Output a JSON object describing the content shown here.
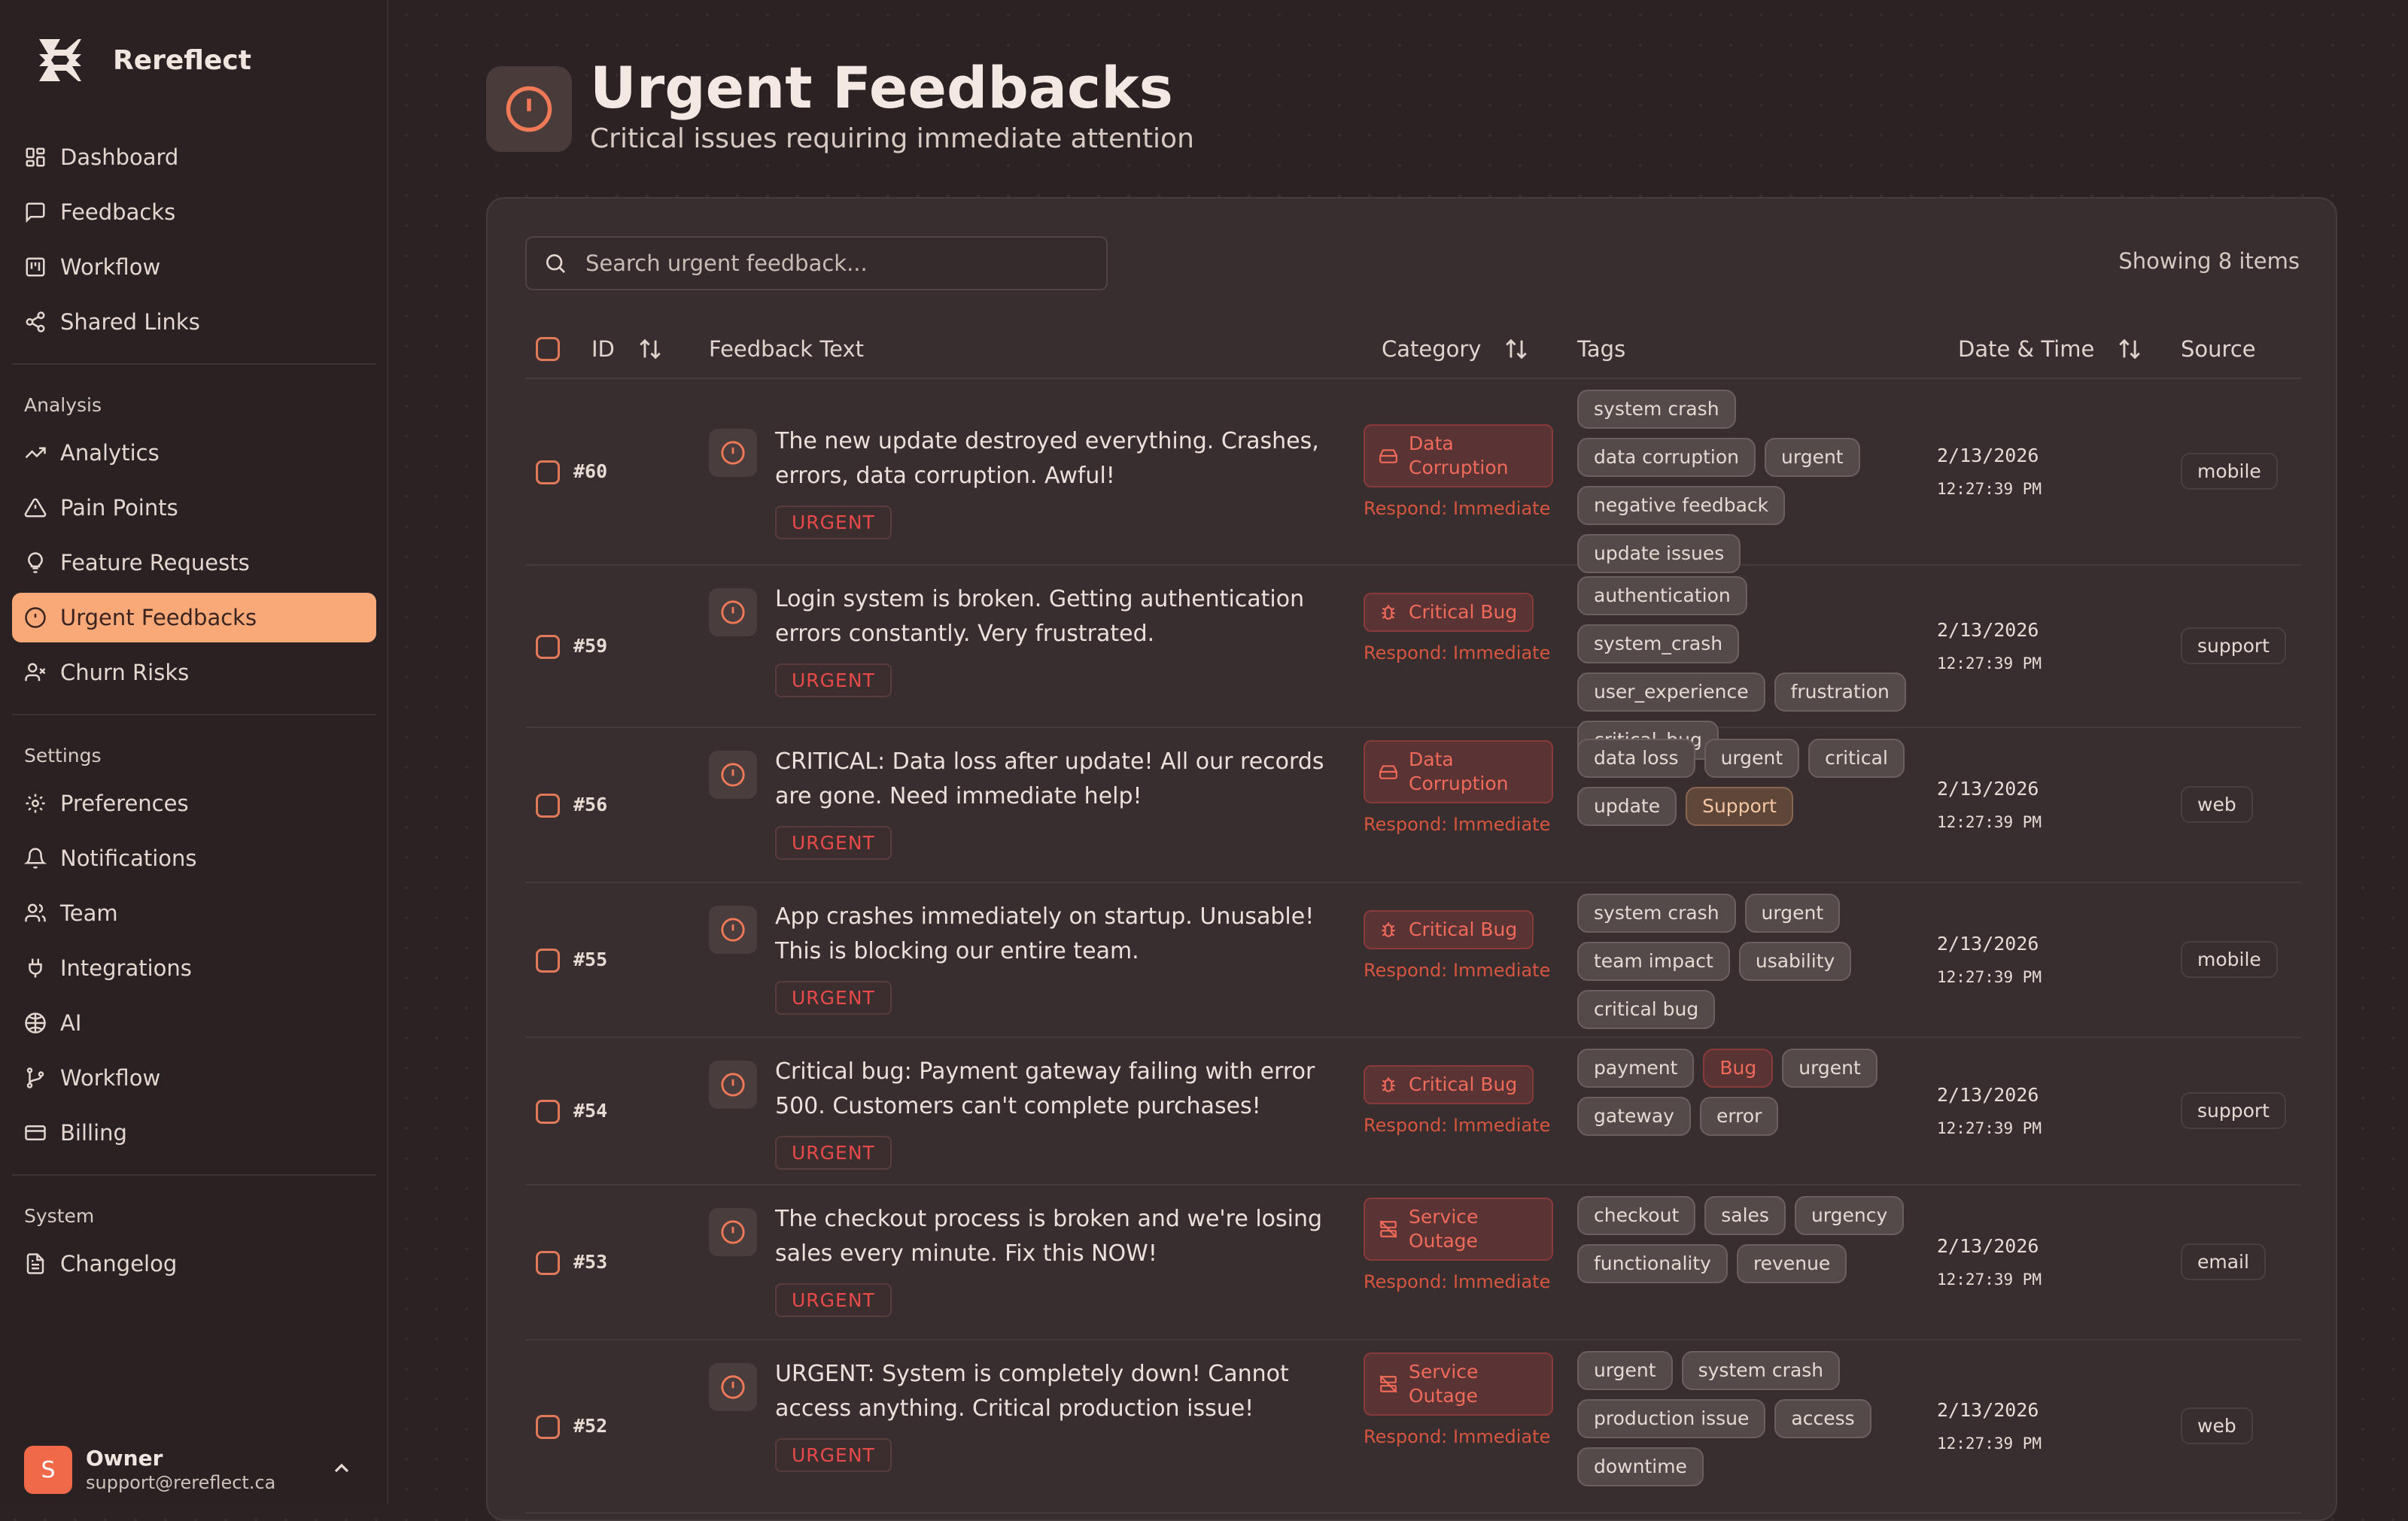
{
  "brand": {
    "name": "Rereflect"
  },
  "sidebar": {
    "main_items": [
      {
        "label": "Dashboard",
        "icon": "dashboard-icon"
      },
      {
        "label": "Feedbacks",
        "icon": "message-square-icon"
      },
      {
        "label": "Workflow",
        "icon": "kanban-icon"
      },
      {
        "label": "Shared Links",
        "icon": "share-icon"
      }
    ],
    "analysis_label": "Analysis",
    "analysis_items": [
      {
        "label": "Analytics",
        "icon": "trending-up-icon"
      },
      {
        "label": "Pain Points",
        "icon": "alert-triangle-icon"
      },
      {
        "label": "Feature Requests",
        "icon": "lightbulb-icon"
      },
      {
        "label": "Urgent Feedbacks",
        "icon": "alert-circle-icon",
        "active": true
      },
      {
        "label": "Churn Risks",
        "icon": "user-x-icon"
      }
    ],
    "settings_label": "Settings",
    "settings_items": [
      {
        "label": "Preferences",
        "icon": "gear-icon"
      },
      {
        "label": "Notifications",
        "icon": "bell-icon"
      },
      {
        "label": "Team",
        "icon": "users-icon"
      },
      {
        "label": "Integrations",
        "icon": "plug-icon"
      },
      {
        "label": "AI",
        "icon": "brain-icon"
      },
      {
        "label": "Workflow",
        "icon": "git-branch-icon"
      },
      {
        "label": "Billing",
        "icon": "credit-card-icon"
      }
    ],
    "system_label": "System",
    "system_items": [
      {
        "label": "Changelog",
        "icon": "file-text-icon"
      }
    ]
  },
  "user": {
    "initial": "S",
    "name": "Owner",
    "email": "support@rereflect.ca"
  },
  "header": {
    "title": "Urgent Feedbacks",
    "subtitle": "Critical issues requiring immediate attention"
  },
  "search": {
    "placeholder": "Search urgent feedback...",
    "value": ""
  },
  "showing": "Showing 8 items",
  "columns": {
    "id": "ID",
    "feedback_text": "Feedback Text",
    "category": "Category",
    "tags": "Tags",
    "date_time": "Date & Time",
    "source": "Source"
  },
  "rows": [
    {
      "id": "#60",
      "text": "The new update destroyed everything. Crashes, errors, data corruption. Awful!",
      "badge": "URGENT",
      "category": "Data Corruption",
      "category_icon": "hard-drive-icon",
      "respond": "Respond: Immediate",
      "tags": [
        "system crash",
        "data corruption",
        "urgent",
        "negative feedback",
        "update issues"
      ],
      "date": "2/13/2026",
      "time": "12:27:39 PM",
      "source": "mobile"
    },
    {
      "id": "#59",
      "text": "Login system is broken. Getting authentication errors constantly. Very frustrated.",
      "badge": "URGENT",
      "category": "Critical Bug",
      "category_icon": "bug-icon",
      "respond": "Respond: Immediate",
      "tags": [
        "authentication",
        "system_crash",
        "user_experience",
        "frustration",
        "critical_bug"
      ],
      "date": "2/13/2026",
      "time": "12:27:39 PM",
      "source": "support"
    },
    {
      "id": "#56",
      "text": "CRITICAL: Data loss after update! All our records are gone. Need immediate help!",
      "badge": "URGENT",
      "category": "Data Corruption",
      "category_icon": "hard-drive-icon",
      "respond": "Respond: Immediate",
      "tags": [
        "data loss",
        "urgent",
        "critical",
        "update",
        "Support"
      ],
      "date": "2/13/2026",
      "time": "12:27:39 PM",
      "source": "web"
    },
    {
      "id": "#55",
      "text": "App crashes immediately on startup. Unusable! This is blocking our entire team.",
      "badge": "URGENT",
      "category": "Critical Bug",
      "category_icon": "bug-icon",
      "respond": "Respond: Immediate",
      "tags": [
        "system crash",
        "urgent",
        "team impact",
        "usability",
        "critical bug"
      ],
      "date": "2/13/2026",
      "time": "12:27:39 PM",
      "source": "mobile"
    },
    {
      "id": "#54",
      "text": "Critical bug: Payment gateway failing with error 500. Customers can't complete purchases!",
      "badge": "URGENT",
      "category": "Critical Bug",
      "category_icon": "bug-icon",
      "respond": "Respond: Immediate",
      "tags": [
        "payment",
        "Bug",
        "urgent",
        "gateway",
        "error"
      ],
      "date": "2/13/2026",
      "time": "12:27:39 PM",
      "source": "support"
    },
    {
      "id": "#53",
      "text": "The checkout process is broken and we're losing sales every minute. Fix this NOW!",
      "badge": "URGENT",
      "category": "Service Outage",
      "category_icon": "server-off-icon",
      "respond": "Respond: Immediate",
      "tags": [
        "checkout",
        "sales",
        "urgency",
        "functionality",
        "revenue"
      ],
      "date": "2/13/2026",
      "time": "12:27:39 PM",
      "source": "email"
    },
    {
      "id": "#52",
      "text": "URGENT: System is completely down! Cannot access anything. Critical production issue!",
      "badge": "URGENT",
      "category": "Service Outage",
      "category_icon": "server-off-icon",
      "respond": "Respond: Immediate",
      "tags": [
        "urgent",
        "system crash",
        "production issue",
        "access",
        "downtime"
      ],
      "date": "2/13/2026",
      "time": "12:27:39 PM",
      "source": "web"
    }
  ]
}
